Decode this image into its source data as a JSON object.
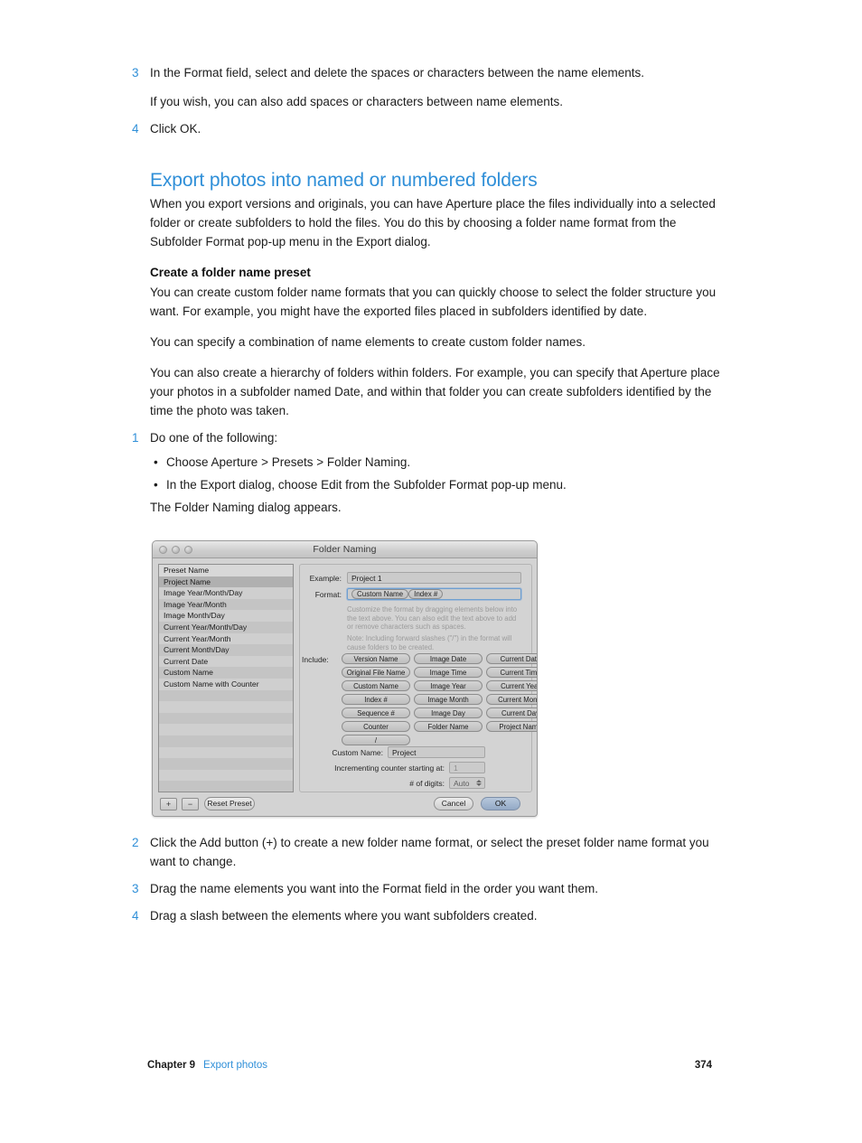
{
  "document": {
    "intro_steps": [
      {
        "num": "3",
        "text": "In the Format field, select and delete the spaces or characters between the name elements."
      },
      {
        "num": "4",
        "text": "Click OK."
      }
    ],
    "intro_note": "If you wish, you can also add spaces or characters between name elements.",
    "section_heading": "Export photos into named or numbered folders",
    "section_intro": "When you export versions and originals, you can have Aperture place the files individually into a selected folder or create subfolders to hold the files. You do this by choosing a folder name format from the Subfolder Format pop-up menu in the Export dialog.",
    "subsection_heading": "Create a folder name preset",
    "subsection_para1": "You can create custom folder name formats that you can quickly choose to select the folder structure you want. For example, you might have the exported files placed in subfolders identified by date.",
    "subsection_para2": "You can specify a combination of name elements to create custom folder names.",
    "subsection_para3": "You can also create a hierarchy of folders within folders. For example, you can specify that Aperture place your photos in a subfolder named Date, and within that folder you can create subfolders identified by the time the photo was taken.",
    "step1": {
      "num": "1",
      "text": "Do one of the following:"
    },
    "bullets": [
      "Choose Aperture > Presets > Folder Naming.",
      "In the Export dialog, choose Edit from the Subfolder Format pop-up menu."
    ],
    "after_bullets": "The Folder Naming dialog appears.",
    "closing_steps": [
      {
        "num": "2",
        "text": "Click the Add button (+) to create a new folder name format, or select the preset folder name format you want to change."
      },
      {
        "num": "3",
        "text": "Drag the name elements you want into the Format field in the order you want them."
      },
      {
        "num": "4",
        "text": "Drag a slash between the elements where you want subfolders created."
      }
    ],
    "footer": {
      "chapter": "Chapter 9",
      "link": "Export photos",
      "page": "374"
    },
    "accent_color": "#2f8fd8"
  },
  "dialog": {
    "title": "Folder Naming",
    "preset_list": {
      "header": "Preset Name",
      "items": [
        "Project Name",
        "Image Year/Month/Day",
        "Image Year/Month",
        "Image Month/Day",
        "Current Year/Month/Day",
        "Current Year/Month",
        "Current Month/Day",
        "Current Date",
        "Custom Name",
        "Custom Name with Counter"
      ],
      "selected": "Project Name"
    },
    "example": {
      "label": "Example:",
      "value": "Project 1"
    },
    "format": {
      "label": "Format:",
      "tokens": [
        "Custom Name",
        "Index #"
      ]
    },
    "hint1": "Customize the format by dragging elements below into the text above. You can also edit the text above to add or remove characters such as spaces.",
    "hint2": "Note: Including forward slashes (\"/\") in the format will cause folders to be created.",
    "include": {
      "label": "Include:",
      "tokens": [
        [
          "Version Name",
          "Image Date",
          "Current Date"
        ],
        [
          "Original File Name",
          "Image Time",
          "Current Time"
        ],
        [
          "Custom Name",
          "Image Year",
          "Current Year"
        ],
        [
          "Index #",
          "Image Month",
          "Current Month"
        ],
        [
          "Sequence #",
          "Image Day",
          "Current Day"
        ],
        [
          "Counter",
          "Folder Name",
          "Project Name"
        ],
        [
          "/",
          "",
          ""
        ]
      ]
    },
    "custom_name": {
      "label": "Custom Name:",
      "value": "Project"
    },
    "counter_start": {
      "label": "Incrementing counter starting at:",
      "value": "1"
    },
    "digits": {
      "label": "# of digits:",
      "value": "Auto"
    },
    "buttons": {
      "add": "+",
      "remove": "−",
      "reset": "Reset Preset",
      "cancel": "Cancel",
      "ok": "OK"
    }
  }
}
